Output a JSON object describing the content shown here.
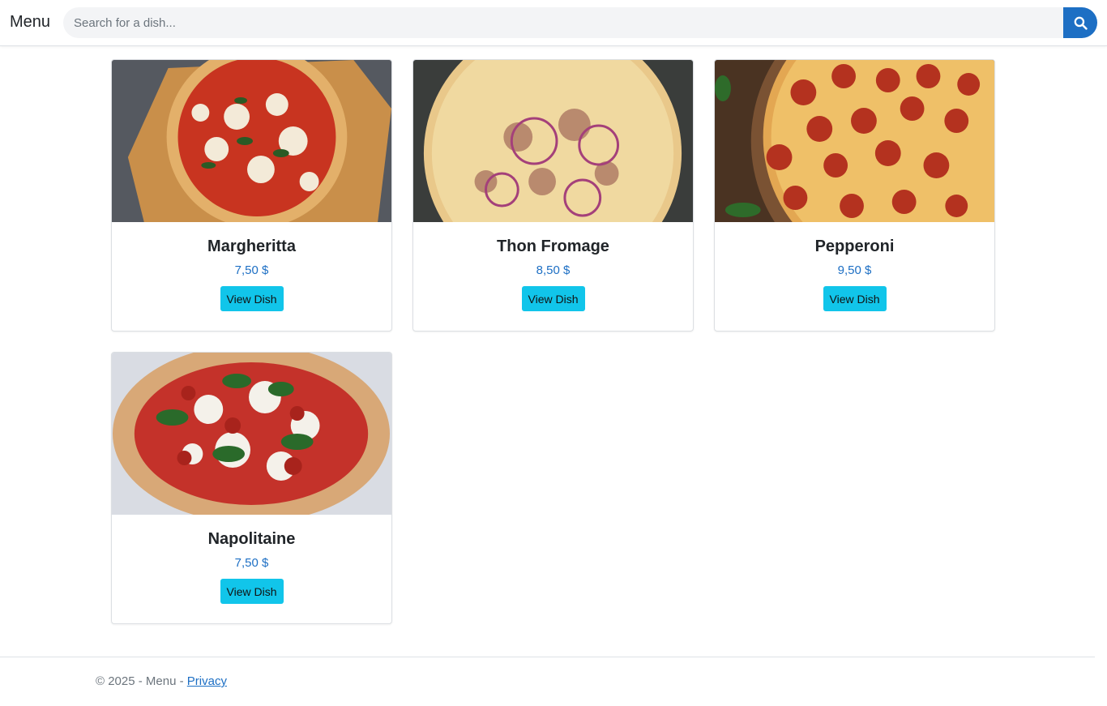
{
  "header": {
    "brand": "Menu",
    "search": {
      "placeholder": "Search for a dish...",
      "value": ""
    },
    "search_icon": "search-icon"
  },
  "dishes": [
    {
      "name": "Margheritta",
      "price": "7,50 $",
      "button": "View Dish"
    },
    {
      "name": "Thon Fromage",
      "price": "8,50 $",
      "button": "View Dish"
    },
    {
      "name": "Pepperoni",
      "price": "9,50 $",
      "button": "View Dish"
    },
    {
      "name": "Napolitaine",
      "price": "7,50 $",
      "button": "View Dish"
    }
  ],
  "footer": {
    "text": "© 2025 - Menu - ",
    "privacy_link": "Privacy"
  },
  "colors": {
    "primary": "#1d6fc4",
    "button_info": "#11c5ea"
  }
}
